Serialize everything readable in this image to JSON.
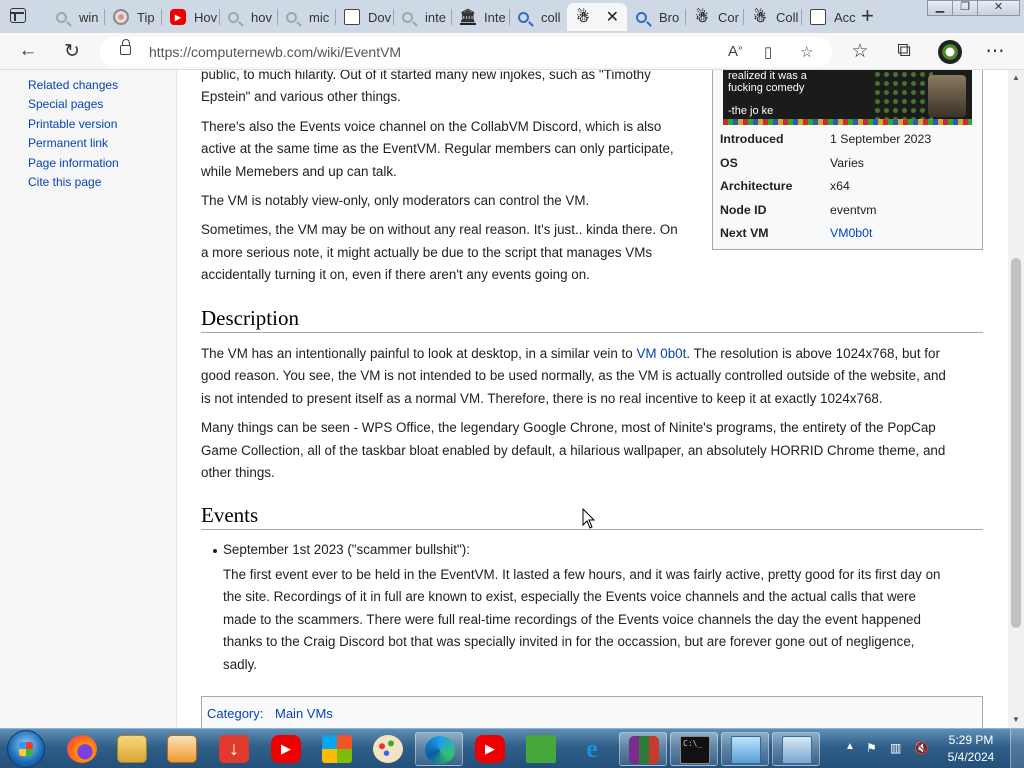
{
  "tabs": [
    {
      "title": "win",
      "icon": "search-icon"
    },
    {
      "title": "Tip",
      "icon": "circle-icon"
    },
    {
      "title": "Hov",
      "icon": "youtube-icon"
    },
    {
      "title": "hov",
      "icon": "search-icon"
    },
    {
      "title": "mic",
      "icon": "search-icon"
    },
    {
      "title": "Dov",
      "icon": "document-icon"
    },
    {
      "title": "inte",
      "icon": "search-icon"
    },
    {
      "title": "Inte",
      "icon": "archive-icon"
    },
    {
      "title": "coll",
      "icon": "search-icon"
    },
    {
      "title": "",
      "icon": "wiki-icon",
      "active": true
    },
    {
      "title": "Bro",
      "icon": "search-icon"
    },
    {
      "title": "Cor",
      "icon": "wiki-icon"
    },
    {
      "title": "Coll",
      "icon": "wiki-icon"
    },
    {
      "title": "Acc",
      "icon": "document-icon"
    }
  ],
  "address": {
    "url": "https://computernewb.com/wiki/EventVM"
  },
  "sidebar": {
    "links": [
      "Related changes",
      "Special pages",
      "Printable version",
      "Permanent link",
      "Page information",
      "Cite this page"
    ]
  },
  "content": {
    "p_top_1": "public, to much hilarity. Out of it started many new injokes, such as \"Timothy",
    "p_top_2": "Epstein\" and various other things.",
    "p_voice_1": "There's also the Events voice channel on the CollabVM Discord, which is also",
    "p_voice_2": "active at the same time as the EventVM. Regular members can only participate,",
    "p_voice_3": "while Memebers and up can talk.",
    "p_viewonly": "The VM is notably view-only, only moderators can control the VM.",
    "p_sometimes_1": "Sometimes, the VM may be on without any real reason. It's just.. kinda there. On",
    "p_sometimes_2": "a more serious note, it might actually be due to the script that manages VMs",
    "p_sometimes_3": "accidentally turning it on, even if there aren't any events going on.",
    "h_description": "Description",
    "p_desc_1a": "The VM has an intentionally painful to look at desktop, in a similar vein to ",
    "p_desc_1link": "VM 0b0t",
    "p_desc_1b": ". The resolution is above 1024x768, but for",
    "p_desc_2": "good reason. You see, the VM is not intended to be used normally, as the VM is actually controlled outside of the website, and",
    "p_desc_3": "is not intended to present itself as a normal VM. Therefore, there is no real incentive to keep it at exactly 1024x768.",
    "p_many_1": "Many things can be seen - WPS Office, the legendary Google Chrone, most of Ninite's programs, the entirety of the PopCap",
    "p_many_2": "Game Collection, all of the taskbar bloat enabled by default, a hilarious wallpaper, an absolutely HORRID Chrome theme, and",
    "p_many_3": "other things.",
    "h_events": "Events",
    "event_title": "September 1st 2023 (\"scammer bullshit\"):",
    "event_1": "The first event ever to be held in the EventVM. It lasted a few hours, and it was fairly active, pretty good for its first day on",
    "event_2": "the site. Recordings of it in full are known to exist, especially the Events voice channels and the actual calls that were",
    "event_3": "made to the scammers. There were full real-time recordings of the Events voice channels the day the event happened",
    "event_4": "thanks to the Craig Discord bot that was specially invited in for the occassion, but are forever gone out of negligence,",
    "event_5": "sadly.",
    "category_label": "Category:",
    "category_value": "Main VMs"
  },
  "infobox": {
    "image_text_1": "realized it was a",
    "image_text_2": "fucking comedy",
    "image_text_3": "-the jo ke",
    "rows": [
      {
        "key": "Introduced",
        "value": "1 September 2023"
      },
      {
        "key": "OS",
        "value": "Varies"
      },
      {
        "key": "Architecture",
        "value": "x64"
      },
      {
        "key": "Node ID",
        "value": "eventvm"
      },
      {
        "key": "Next VM",
        "value": "VM0b0t"
      }
    ]
  },
  "taskbar": {
    "time": "5:29 PM",
    "date": "5/4/2024",
    "apps": [
      "firefox",
      "file-explorer",
      "media-player",
      "downloader",
      "youtube",
      "store",
      "paint",
      "edge",
      "youtube",
      "minecraft",
      "internet-explorer",
      "winrar",
      "command-prompt",
      "control-panel",
      "remote-desktop"
    ]
  },
  "colors": {
    "link": "#0645ad",
    "tabbar": "#cfd9e6",
    "taskbar": "#2f5f88"
  }
}
